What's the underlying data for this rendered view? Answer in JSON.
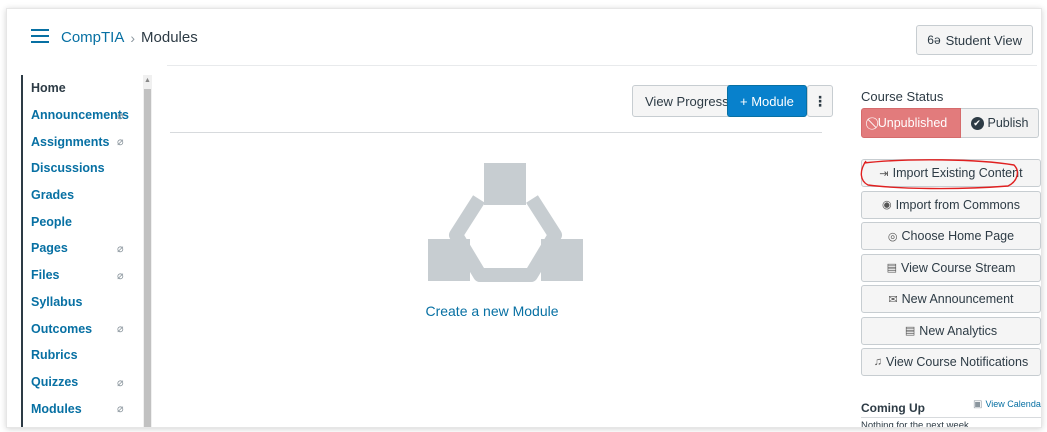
{
  "breadcrumb": {
    "course": "CompTIA",
    "separator": "›",
    "current": "Modules"
  },
  "header": {
    "student_view_label": "Student View",
    "student_view_icon": "glasses-icon"
  },
  "nav": {
    "items": [
      {
        "label": "Home",
        "active": true,
        "hidden": false
      },
      {
        "label": "Announcements",
        "hidden": true
      },
      {
        "label": "Assignments",
        "hidden": true
      },
      {
        "label": "Discussions",
        "hidden": false
      },
      {
        "label": "Grades",
        "hidden": false
      },
      {
        "label": "People",
        "hidden": false
      },
      {
        "label": "Pages",
        "hidden": true
      },
      {
        "label": "Files",
        "hidden": true
      },
      {
        "label": "Syllabus",
        "hidden": false
      },
      {
        "label": "Outcomes",
        "hidden": true
      },
      {
        "label": "Rubrics",
        "hidden": false
      },
      {
        "label": "Quizzes",
        "hidden": true
      },
      {
        "label": "Modules",
        "hidden": true
      }
    ],
    "hidden_glyph": "⌀"
  },
  "toolbar": {
    "view_progress_label": "View Progress",
    "add_module_label": "+ Module",
    "more_label": "⋮"
  },
  "main": {
    "create_module_label": "Create a new Module"
  },
  "sidebar": {
    "course_status_title": "Course Status",
    "unpublished_label": "Unpublished",
    "publish_label": "Publish",
    "buttons": [
      {
        "label": "Import Existing Content",
        "icon": "import-icon",
        "glyph": "⇥"
      },
      {
        "label": "Import from Commons",
        "icon": "commons-icon",
        "glyph": "◉"
      },
      {
        "label": "Choose Home Page",
        "icon": "target-icon",
        "glyph": "◎"
      },
      {
        "label": "View Course Stream",
        "icon": "stream-icon",
        "glyph": "▤"
      },
      {
        "label": "New Announcement",
        "icon": "megaphone-icon",
        "glyph": "✉"
      },
      {
        "label": "New Analytics",
        "icon": "analytics-icon",
        "glyph": "▤"
      },
      {
        "label": "View Course Notifications",
        "icon": "bell-icon",
        "glyph": "♫"
      }
    ],
    "coming_up_title": "Coming Up",
    "view_calendar_label": "View Calendar",
    "nothing_label": "Nothing for the next week"
  },
  "colors": {
    "link": "#0770a3",
    "primary": "#0881cc",
    "unpublished": "#e27b7c",
    "annotation": "#e02020"
  }
}
